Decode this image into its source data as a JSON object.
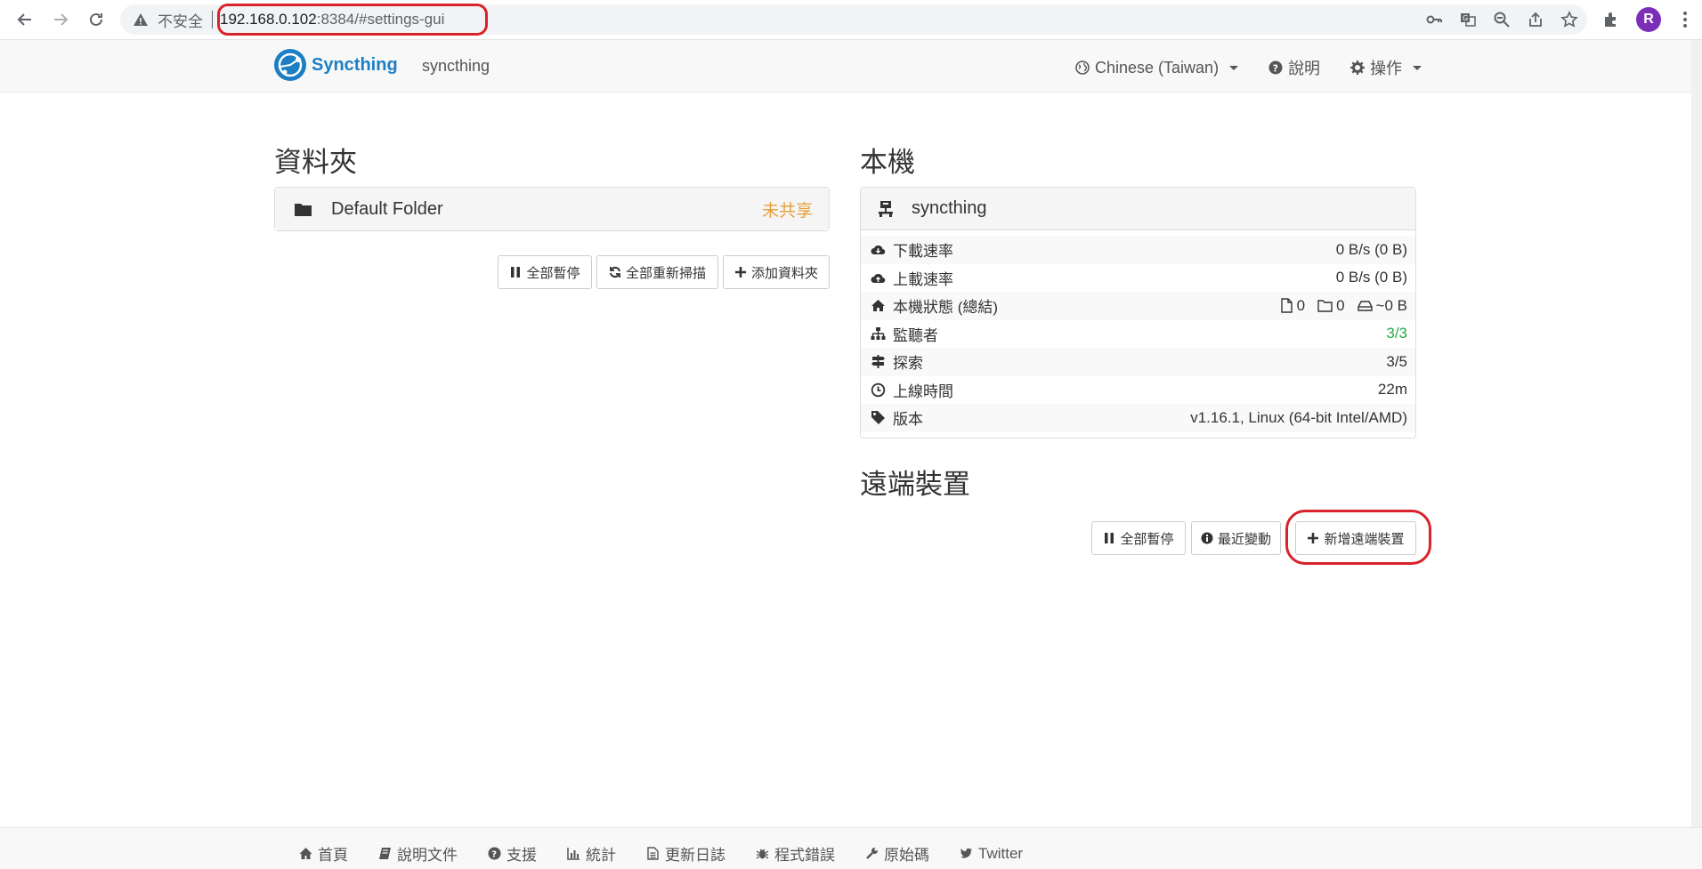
{
  "browser": {
    "insecure_label": "不安全",
    "url_host": "192.168.0.102",
    "url_rest": ":8384/#settings-gui",
    "profile_initial": "R"
  },
  "navbar": {
    "brand": "Syncthing",
    "device_name": "syncthing",
    "language": "Chinese (Taiwan)",
    "help": "說明",
    "actions": "操作"
  },
  "folders": {
    "heading": "資料夾",
    "items": [
      {
        "name": "Default Folder",
        "status": "未共享"
      }
    ],
    "buttons": {
      "pause_all": "全部暫停",
      "rescan_all": "全部重新掃描",
      "add_folder": "添加資料夾"
    }
  },
  "this_device": {
    "heading": "本機",
    "name": "syncthing",
    "stats": {
      "download_label": "下載速率",
      "download_value": "0 B/s (0 B)",
      "upload_label": "上載速率",
      "upload_value": "0 B/s (0 B)",
      "local_state_label": "本機狀態 (總結)",
      "files": "0",
      "dirs": "0",
      "size": "~0 B",
      "listeners_label": "監聽者",
      "listeners_value": "3/3",
      "discovery_label": "探索",
      "discovery_value": "3/5",
      "uptime_label": "上線時間",
      "uptime_value": "22m",
      "version_label": "版本",
      "version_value": "v1.16.1, Linux (64-bit Intel/AMD)"
    }
  },
  "remote_devices": {
    "heading": "遠端裝置",
    "buttons": {
      "pause_all": "全部暫停",
      "recent_changes": "最近變動",
      "add_remote": "新增遠端裝置"
    }
  },
  "footer": {
    "home": "首頁",
    "docs": "說明文件",
    "support": "支援",
    "stats": "統計",
    "changelog": "更新日誌",
    "bugs": "程式錯誤",
    "source": "原始碼",
    "twitter": "Twitter"
  },
  "colors": {
    "brand": "#1c7fc4",
    "unshared": "#e59e3a",
    "ok": "#28a745",
    "highlight": "#d8232a"
  }
}
